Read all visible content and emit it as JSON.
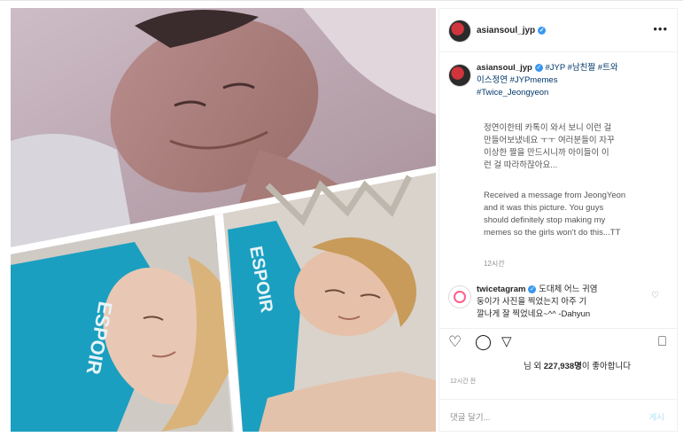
{
  "post": {
    "username": "asiansoul_jyp",
    "more_icon": "ellipsis-icon",
    "caption_user": "asiansoul_jyp",
    "hashtags_line1": " #JYP #남친짤 #트와",
    "hashtags_line2": "이스정연 #JYPmemes",
    "hashtags_line3": "#Twice_Jeongyeon",
    "caption_korean": "정연이한테 카톡이 와서 보니 이런 걸\n만들어보냈네요 ㅜㅜ 여러분들이 자꾸\n이상한 짤을 만드시니까 아이들이 이\n런 걸 따라하잖아요...",
    "caption_english": "Received a message from JeongYeon\nand it was this picture. You guys\nshould definitely stop making my\nmemes so the girls won't do this...TT",
    "caption_time": "12시간",
    "comment_user": "twicetagram",
    "comment_text": " 도대체 어느 귀염\n둥이가 사진을 찍었는지 아주 기\n깔나게 잘 찍었네요~^^ -Dahyun",
    "likes_prefix": "님 외 ",
    "likes_count": "227,938명",
    "likes_suffix": "이 좋아합니다",
    "post_time": "12시간 전",
    "comment_placeholder": "댓글 달기...",
    "post_button": "게시",
    "shirt_text_left": "ESPOIR",
    "shirt_text_right": "ESPOIR"
  },
  "colors": {
    "link": "#00376b",
    "verified": "#3897f0",
    "shirt": "#1a9fc0"
  }
}
